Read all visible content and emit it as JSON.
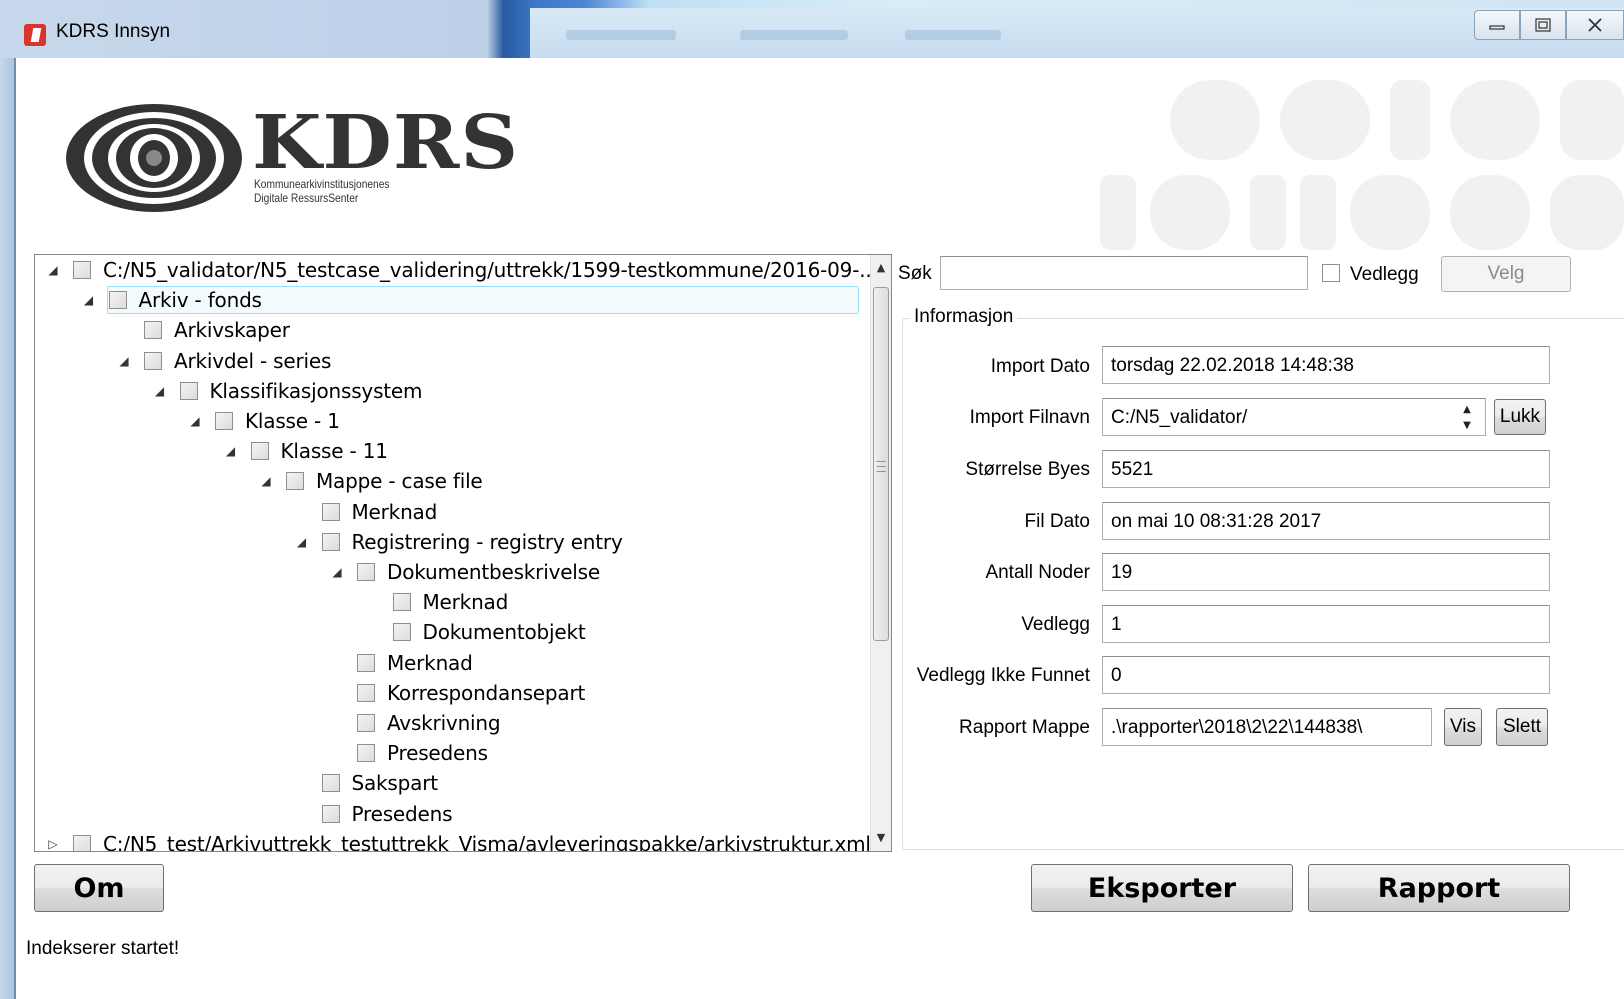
{
  "window": {
    "title": "KDRS Innsyn",
    "controls": [
      "minimize-icon",
      "maximize-icon",
      "close-icon"
    ]
  },
  "logo": {
    "name": "KDRS",
    "subtitle_line1": "Kommunearkivinstitusjonenes",
    "subtitle_line2": "Digitale RessursSenter"
  },
  "tree": {
    "items": [
      {
        "label": "C:/N5_validator/N5_testcase_validering/uttrekk/1599-testkommune/2016-09-...",
        "level": 0,
        "expanded": true
      },
      {
        "label": "Arkiv - fonds",
        "level": 1,
        "expanded": true,
        "selected": true
      },
      {
        "label": "Arkivskaper",
        "level": 2,
        "leaf": true
      },
      {
        "label": "Arkivdel - series",
        "level": 2,
        "expanded": true
      },
      {
        "label": "Klassifikasjonssystem",
        "level": 3,
        "expanded": true
      },
      {
        "label": "Klasse - 1",
        "level": 4,
        "expanded": true
      },
      {
        "label": "Klasse - 11",
        "level": 5,
        "expanded": true
      },
      {
        "label": "Mappe - case file",
        "level": 6,
        "expanded": true
      },
      {
        "label": "Merknad",
        "level": 7,
        "leaf": true
      },
      {
        "label": "Registrering - registry entry",
        "level": 7,
        "expanded": true
      },
      {
        "label": "Dokumentbeskrivelse",
        "level": 8,
        "expanded": true
      },
      {
        "label": "Merknad",
        "level": 9,
        "leaf": true
      },
      {
        "label": "Dokumentobjekt",
        "level": 9,
        "leaf": true
      },
      {
        "label": "Merknad",
        "level": 8,
        "leaf": true
      },
      {
        "label": "Korrespondansepart",
        "level": 8,
        "leaf": true
      },
      {
        "label": "Avskrivning",
        "level": 8,
        "leaf": true
      },
      {
        "label": "Presedens",
        "level": 8,
        "leaf": true
      },
      {
        "label": "Sakspart",
        "level": 7,
        "leaf": true
      },
      {
        "label": "Presedens",
        "level": 7,
        "leaf": true
      },
      {
        "label": "C:/N5_test/Arkivuttrekk_testuttrekk_Visma/avleveringspakke/arkivstruktur.xml",
        "level": 0,
        "expanded": false
      }
    ]
  },
  "search": {
    "label": "Søk",
    "value": "",
    "attachment_label": "Vedlegg",
    "select_button": "Velg"
  },
  "info": {
    "group_title": "Informasjon",
    "fields": {
      "import_date": {
        "label": "Import Dato",
        "value": "torsdag 22.02.2018 14:48:38"
      },
      "import_filename": {
        "label": "Import Filnavn",
        "value": "C:/N5_validator/"
      },
      "size_bytes": {
        "label": "Størrelse Byes",
        "value": "5521"
      },
      "file_date": {
        "label": "Fil Dato",
        "value": "on mai 10 08:31:28 2017"
      },
      "node_count": {
        "label": "Antall Noder",
        "value": "19"
      },
      "attachments": {
        "label": "Vedlegg",
        "value": "1"
      },
      "attachments_not_found": {
        "label": "Vedlegg Ikke Funnet",
        "value": "0"
      },
      "report_folder": {
        "label": "Rapport Mappe",
        "value": ".\\rapporter\\2018\\2\\22\\144838\\"
      }
    },
    "close_button": "Lukk",
    "show_button": "Vis",
    "delete_button": "Slett"
  },
  "buttons": {
    "about": "Om",
    "export": "Eksporter",
    "report": "Rapport"
  },
  "status": "Indekserer startet!"
}
